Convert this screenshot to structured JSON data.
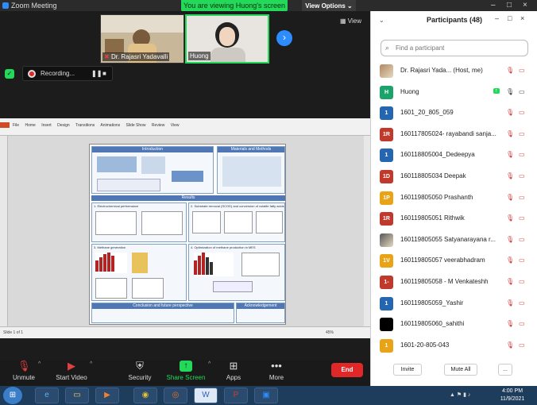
{
  "window": {
    "title": "Zoom Meeting",
    "min": "–",
    "max": "□",
    "close": "×"
  },
  "banner": {
    "viewing_text": "You are viewing Huong's screen",
    "view_options": "View Options ⌄"
  },
  "thumbnails": [
    {
      "name": "Dr. Rajasri Yadavalli",
      "muted": true
    },
    {
      "name": "Huong",
      "muted": false
    }
  ],
  "view_label": "View",
  "recording": {
    "label": "Recording..."
  },
  "shared_doc": {
    "menu": [
      "File",
      "Home",
      "Insert",
      "Design",
      "Transitions",
      "Animations",
      "Slide Show",
      "Review",
      "View"
    ],
    "sections": {
      "introduction": "Introduction",
      "methods": "Materials and Methods",
      "results": "Results",
      "electrochemical": "1. Electrochemical performance",
      "substrate": "2. Substrate removal (SCOD) and conversion of volatile fatty acids (VFAs)",
      "methane": "3. Methane generation",
      "optimization": "4. Optimization of methane production in MES",
      "conclusion": "Conclusion and future perspective",
      "acknowledgement": "Acknowledgement"
    },
    "status_left": "Slide 1 of 1",
    "zoom": "45%"
  },
  "toolbar": {
    "unmute": "Unmute",
    "start_video": "Start Video",
    "security": "Security",
    "share_screen": "Share Screen",
    "apps": "Apps",
    "more": "More",
    "end": "End"
  },
  "participants": {
    "title": "Participants (48)",
    "search_placeholder": "Find a participant",
    "list": [
      {
        "initials": "",
        "name": "Dr. Rajasri Yada...  (Host, me)",
        "color": "#b08860",
        "photo": true
      },
      {
        "initials": "H",
        "name": "Huong",
        "color": "#1aa36b"
      },
      {
        "initials": "1",
        "name": "1601_20_805_059",
        "color": "#2566b0"
      },
      {
        "initials": "1R",
        "name": "160117805024- rayabandi sanja...",
        "color": "#c0392b"
      },
      {
        "initials": "1",
        "name": "160118805004_Dedeepya",
        "color": "#2566b0"
      },
      {
        "initials": "1D",
        "name": "160118805034 Deepak",
        "color": "#c0392b"
      },
      {
        "initials": "1P",
        "name": "160119805050 Prashanth",
        "color": "#e8a317"
      },
      {
        "initials": "1R",
        "name": "160119805051 Rithwik",
        "color": "#c0392b"
      },
      {
        "initials": "",
        "name": "160119805055 Satyanarayana r...",
        "color": "#555555",
        "photo": true
      },
      {
        "initials": "1V",
        "name": "160119805057 veerabhadram",
        "color": "#e8a317"
      },
      {
        "initials": "1-",
        "name": "160119805058 -  M Venkateshh",
        "color": "#c0392b"
      },
      {
        "initials": "1",
        "name": "160119805059_Yashir",
        "color": "#2566b0"
      },
      {
        "initials": "",
        "name": "160119805060_sahithi",
        "color": "#000000"
      },
      {
        "initials": "1",
        "name": "1601-20-805-043",
        "color": "#e8a317"
      }
    ],
    "invite": "Invite",
    "mute_all": "Mute All",
    "more": "..."
  },
  "taskbar": {
    "time": "4:00 PM",
    "date": "11/9/2021"
  }
}
